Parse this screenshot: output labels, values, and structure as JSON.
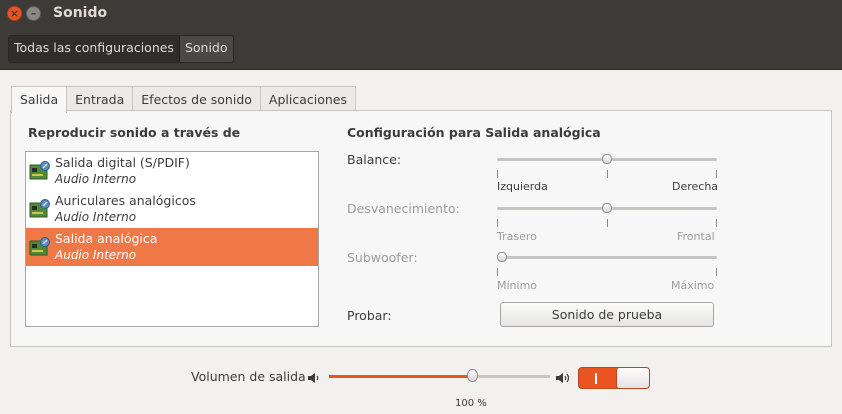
{
  "window": {
    "title": "Sonido"
  },
  "breadcrumb": {
    "all_settings": "Todas las configuraciones",
    "current": "Sonido"
  },
  "tabs": [
    {
      "label": "Salida",
      "active": true
    },
    {
      "label": "Entrada"
    },
    {
      "label": "Efectos de sonido"
    },
    {
      "label": "Aplicaciones"
    }
  ],
  "output": {
    "list_heading": "Reproducir sonido a través de",
    "devices": [
      {
        "name": "Salida digital (S/PDIF)",
        "sub": "Audio Interno",
        "icon": "sound-card-icon",
        "selected": false
      },
      {
        "name": "Auriculares analógicos",
        "sub": "Audio Interno",
        "icon": "sound-card-icon",
        "selected": false
      },
      {
        "name": "Salida analógica",
        "sub": "Audio Interno",
        "icon": "sound-card-icon",
        "selected": true
      }
    ],
    "config_heading": "Configuración para Salida analógica",
    "balance": {
      "label": "Balance:",
      "left": "Izquierda",
      "right": "Derecha",
      "value": 0.5
    },
    "fade": {
      "label": "Desvanecimiento:",
      "left": "Trasero",
      "right": "Frontal",
      "value": 0.5
    },
    "subwoofer": {
      "label": "Subwoofer:",
      "left": "Mínimo",
      "right": "Máximo",
      "value": 0.0
    },
    "test": {
      "label": "Probar:",
      "button": "Sonido de prueba"
    }
  },
  "volume": {
    "label": "Volumen de salida",
    "percent_text": "100 %",
    "value": 0.645,
    "muted": false
  },
  "colors": {
    "accent": "#e95420",
    "selection": "#f07746",
    "titlebar": "#3c3b37"
  }
}
